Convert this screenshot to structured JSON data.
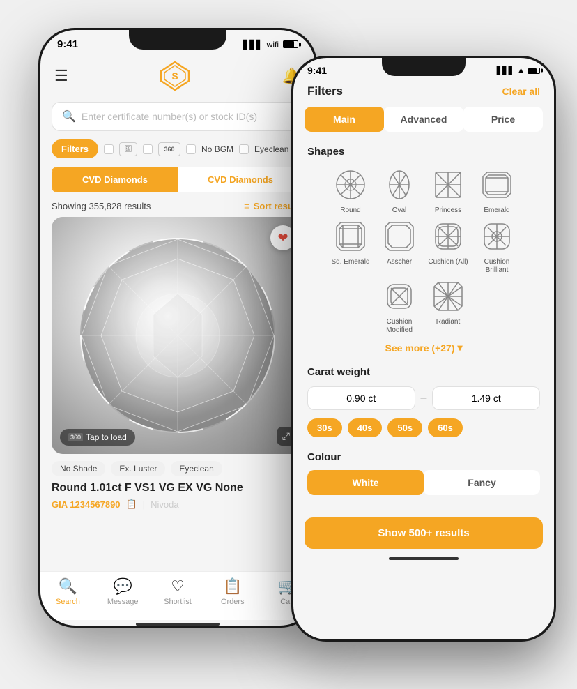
{
  "phone1": {
    "status_time": "9:41",
    "search_placeholder": "Enter certificate number(s) or stock ID(s)",
    "filters_label": "Filters",
    "filter_options": [
      "No BGM",
      "Eyeclean"
    ],
    "tab_left": "CVD Diamonds",
    "tab_right": "CVD Diamonds",
    "results_text": "Showing 355,828 results",
    "sort_label": "Sort results",
    "tags": [
      "No Shade",
      "Ex. Luster",
      "Eyeclean"
    ],
    "diamond_title": "Round 1.01ct F VS1 VG EX VG None",
    "gia_label": "GIA 1234567890",
    "vendor": "Nivoda",
    "tap_load": "Tap to load",
    "heart": "❤",
    "nav_items": [
      {
        "label": "Search",
        "active": true,
        "icon": "🔍"
      },
      {
        "label": "Message",
        "active": false,
        "icon": "💬"
      },
      {
        "label": "Shortlist",
        "active": false,
        "icon": "♡"
      },
      {
        "label": "Orders",
        "active": false,
        "icon": "📋"
      },
      {
        "label": "Cart",
        "active": false,
        "icon": "🛒"
      }
    ]
  },
  "phone2": {
    "status_time": "9:41",
    "title": "Filters",
    "clear_all": "Clear all",
    "tabs": [
      "Main",
      "Advanced",
      "Price"
    ],
    "active_tab": "Main",
    "shapes_section_title": "Shapes",
    "shapes": [
      {
        "label": "Round",
        "type": "round"
      },
      {
        "label": "Oval",
        "type": "oval"
      },
      {
        "label": "Princess",
        "type": "princess"
      },
      {
        "label": "Emerald",
        "type": "emerald"
      },
      {
        "label": "Sq. Emerald",
        "type": "sq-emerald"
      },
      {
        "label": "Asscher",
        "type": "asscher"
      },
      {
        "label": "Cushion (All)",
        "type": "cushion"
      },
      {
        "label": "Cushion Brilliant",
        "type": "cushion-brilliant"
      },
      {
        "label": "Cushion Modified",
        "type": "cushion-modified"
      },
      {
        "label": "Radiant",
        "type": "radiant"
      }
    ],
    "see_more_label": "See more (+27)",
    "carat_section_title": "Carat weight",
    "carat_min": "0.90 ct",
    "carat_max": "1.49 ct",
    "carat_presets": [
      "30s",
      "40s",
      "50s",
      "60s"
    ],
    "colour_title": "Colour",
    "colour_tabs": [
      "White",
      "Fancy"
    ],
    "active_colour_tab": "White",
    "show_results_label": "Show 500+ results"
  }
}
